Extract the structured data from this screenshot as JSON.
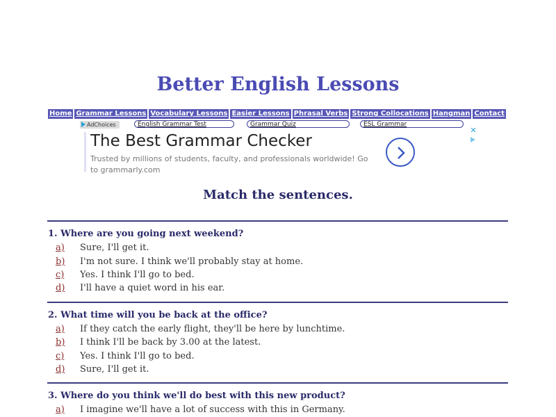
{
  "site": {
    "title": "Better English Lessons"
  },
  "nav": [
    "Home",
    "Grammar Lessons",
    "Vocabulary Lessons",
    "Easier Lessons",
    "Phrasal Verbs",
    "Strong Collocations",
    "Hangman",
    "Contact"
  ],
  "ads": {
    "adchoices_label": "AdChoices",
    "links": [
      "English Grammar Test",
      "Grammar Quiz",
      "ESL Grammar"
    ],
    "headline": "The Best Grammar Checker",
    "body": "Trusted by millions of students, faculty, and professionals worldwide! Go to grammarly.com",
    "close_symbol": "✕",
    "arrow_icon": "chevron-right-icon"
  },
  "page": {
    "heading": "Match the sentences."
  },
  "questions": [
    {
      "text": "1. Where are you going next weekend?",
      "answers": [
        {
          "letter": "a)",
          "text": "Sure, I'll get it."
        },
        {
          "letter": "b)",
          "text": "I'm not sure. I think we'll probably stay at home."
        },
        {
          "letter": "c)",
          "text": "Yes. I think I'll go to bed."
        },
        {
          "letter": "d)",
          "text": "I'll have a quiet word in his ear."
        }
      ]
    },
    {
      "text": "2. What time will you be back at the office?",
      "answers": [
        {
          "letter": "a)",
          "text": "If they catch the early flight, they'll be here by lunchtime."
        },
        {
          "letter": "b)",
          "text": "I think I'll be back by 3.00 at the latest."
        },
        {
          "letter": "c)",
          "text": "Yes. I think I'll go to bed."
        },
        {
          "letter": "d)",
          "text": "Sure, I'll get it."
        }
      ]
    },
    {
      "text": "3. Where do you think we'll do best with this new product?",
      "answers": [
        {
          "letter": "a)",
          "text": "I imagine we'll have a lot of success with this in Germany."
        }
      ]
    }
  ]
}
